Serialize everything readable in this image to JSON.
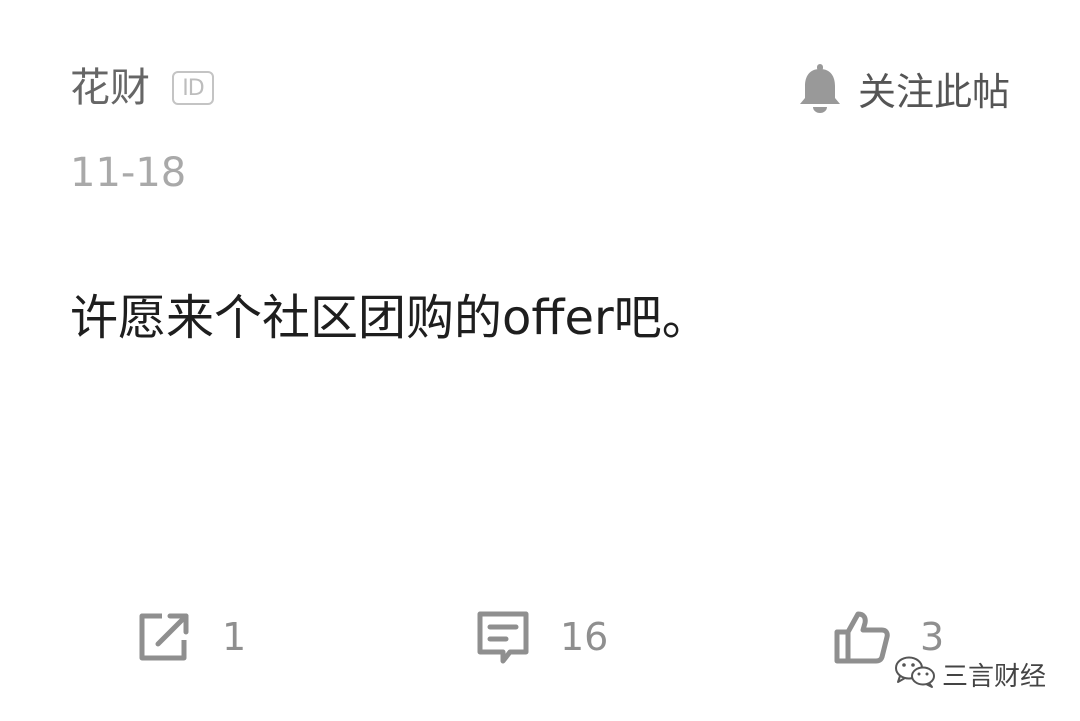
{
  "post": {
    "author": "花财",
    "id_badge": "ID",
    "follow_label": "关注此帖",
    "date": "11-18",
    "content": "许愿来个社区团购的offer吧。"
  },
  "actions": {
    "share_count": "1",
    "comment_count": "16",
    "like_count": "3"
  },
  "watermark": {
    "text": "三言财经"
  },
  "icons": {
    "follow": "bell-icon",
    "share": "share-icon",
    "comment": "comment-icon",
    "like": "thumbs-up-icon",
    "watermark": "wechat-icon"
  },
  "colors": {
    "background": "#ffffff",
    "text_primary": "#1e1e1e",
    "text_secondary": "#666666",
    "text_muted": "#a9a9a9",
    "icon_gray": "#8f8f8f"
  }
}
